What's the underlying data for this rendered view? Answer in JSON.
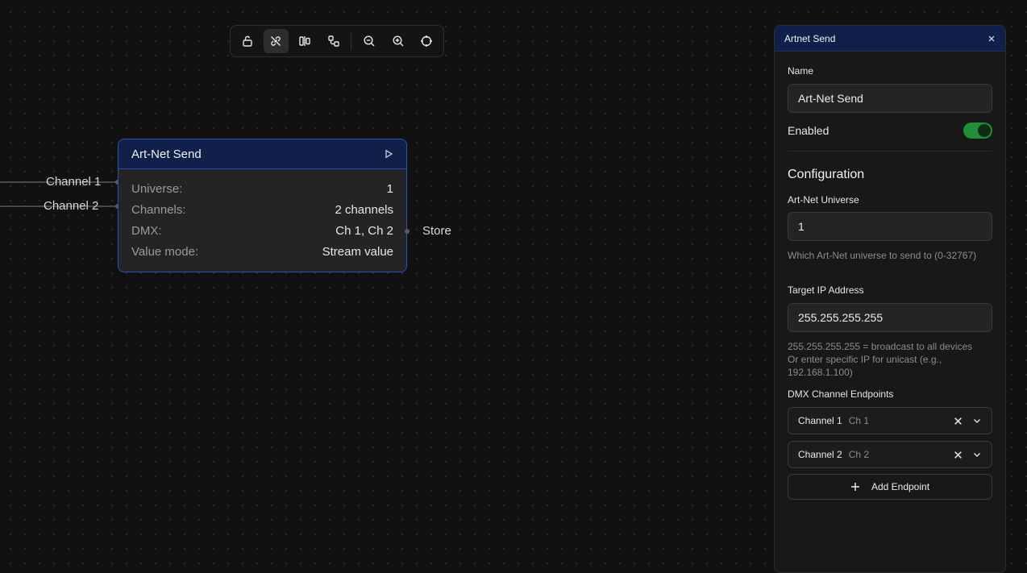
{
  "toolbar": {
    "buttons": [
      {
        "icon": "lock-open-icon",
        "active": false
      },
      {
        "icon": "snap-link-icon",
        "active": true
      },
      {
        "icon": "align-icon",
        "active": false
      },
      {
        "icon": "layout-icon",
        "active": false
      },
      {
        "icon": "zoom-out-icon",
        "active": false
      },
      {
        "icon": "zoom-in-icon",
        "active": false
      },
      {
        "icon": "fit-view-icon",
        "active": false
      }
    ]
  },
  "node": {
    "title": "Art-Net Send",
    "rows": [
      {
        "key": "Universe:",
        "value": "1"
      },
      {
        "key": "Channels:",
        "value": "2 channels"
      },
      {
        "key": "DMX:",
        "value": "Ch 1, Ch 2"
      },
      {
        "key": "Value mode:",
        "value": "Stream value"
      }
    ],
    "inputs": [
      "Channel 1",
      "Channel 2"
    ],
    "output": "Store"
  },
  "panel": {
    "title": "Artnet Send",
    "name_label": "Name",
    "name_value": "Art-Net Send",
    "enabled_label": "Enabled",
    "enabled": true,
    "section_title": "Configuration",
    "universe_label": "Art-Net Universe",
    "universe_value": "1",
    "universe_help": "Which Art-Net universe to send to (0-32767)",
    "ip_label": "Target IP Address",
    "ip_value": "255.255.255.255",
    "ip_help_1": "255.255.255.255 = broadcast to all devices",
    "ip_help_2": "Or enter specific IP for unicast (e.g., 192.168.1.100)",
    "endpoints_label": "DMX Channel Endpoints",
    "endpoints": [
      {
        "name": "Channel 1",
        "channel": "Ch 1"
      },
      {
        "name": "Channel 2",
        "channel": "Ch 2"
      }
    ],
    "add_endpoint_label": "Add Endpoint"
  },
  "colors": {
    "background": "#111111",
    "node_header": "#10204a",
    "node_border": "#2d4fc0",
    "toggle_on": "#1f8f3a"
  }
}
